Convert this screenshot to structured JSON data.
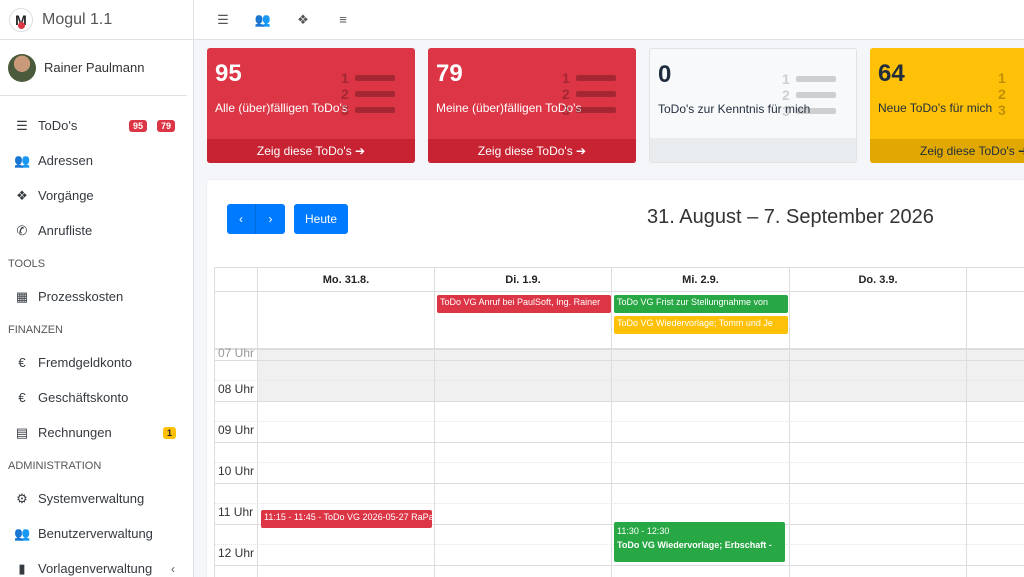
{
  "brand": {
    "name": "Mogul 1.1",
    "logo_letter": "M"
  },
  "user": {
    "name": "Rainer Paulmann"
  },
  "sidebar": {
    "items": [
      {
        "label": "ToDo's",
        "icon": "list-ol-icon"
      },
      {
        "label": "Adressen",
        "icon": "users-icon"
      },
      {
        "label": "Vorgänge",
        "icon": "cubes-icon"
      },
      {
        "label": "Anrufliste",
        "icon": "phone-icon"
      }
    ],
    "todo_badges": [
      "95",
      "79"
    ],
    "tools_header": "TOOLS",
    "tools": [
      {
        "label": "Prozesskosten",
        "icon": "calculator-icon"
      }
    ],
    "finance_header": "FINANZEN",
    "finance": [
      {
        "label": "Fremdgeldkonto",
        "icon": "euro-icon"
      },
      {
        "label": "Geschäftskonto",
        "icon": "euro-icon"
      },
      {
        "label": "Rechnungen",
        "icon": "invoice-icon"
      }
    ],
    "invoice_badge": "1",
    "admin_header": "ADMINISTRATION",
    "admin": [
      {
        "label": "Systemverwaltung",
        "icon": "cogs-icon"
      },
      {
        "label": "Benutzerverwaltung",
        "icon": "users-cog-icon"
      },
      {
        "label": "Vorlagenverwaltung",
        "icon": "file-icon"
      }
    ],
    "chevron": "‹"
  },
  "boxes": [
    {
      "number": "95",
      "label": "Alle (über)fälligen ToDo's",
      "footer": "Zeig diese ToDo's ➔",
      "color": "#dc3545"
    },
    {
      "number": "79",
      "label": "Meine (über)fälligen ToDo's",
      "footer": "Zeig diese ToDo's ➔",
      "color": "#dc3545"
    },
    {
      "number": "0",
      "label": "ToDo's zur Kenntnis für mich",
      "footer": "",
      "color": "#f8f9fa"
    },
    {
      "number": "64",
      "label": "Neue ToDo's für mich",
      "footer": "Zeig diese ToDo's ➔",
      "color": "#ffc107"
    }
  ],
  "calendar": {
    "prev": "‹",
    "next": "›",
    "today": "Heute",
    "title": "31. August – 7. September 2026",
    "days": [
      "Mo. 31.8.",
      "Di. 1.9.",
      "Mi. 2.9.",
      "Do. 3.9.",
      ""
    ],
    "hours": [
      "07 Uhr",
      "08 Uhr",
      "09 Uhr",
      "10 Uhr",
      "11 Uhr",
      "12 Uhr"
    ],
    "allday_events": [
      {
        "text": "ToDo VG Anruf bei PaulSoft, Ing. Rainer",
        "color": "red"
      },
      {
        "text": "ToDo VG Frist zur Stellungnahme von",
        "color": "green"
      },
      {
        "text": "ToDo VG Wiedervorlage; Tomm und Je",
        "color": "yellow"
      }
    ],
    "timed_events": [
      {
        "time": "",
        "text": "11:15 - 11:45 - ToDo VG 2026-05-27 RaPa;",
        "color": "red"
      },
      {
        "time": "11:30 - 12:30",
        "text": "ToDo VG Wiedervorlage; Erbschaft -",
        "color": "green"
      }
    ]
  }
}
